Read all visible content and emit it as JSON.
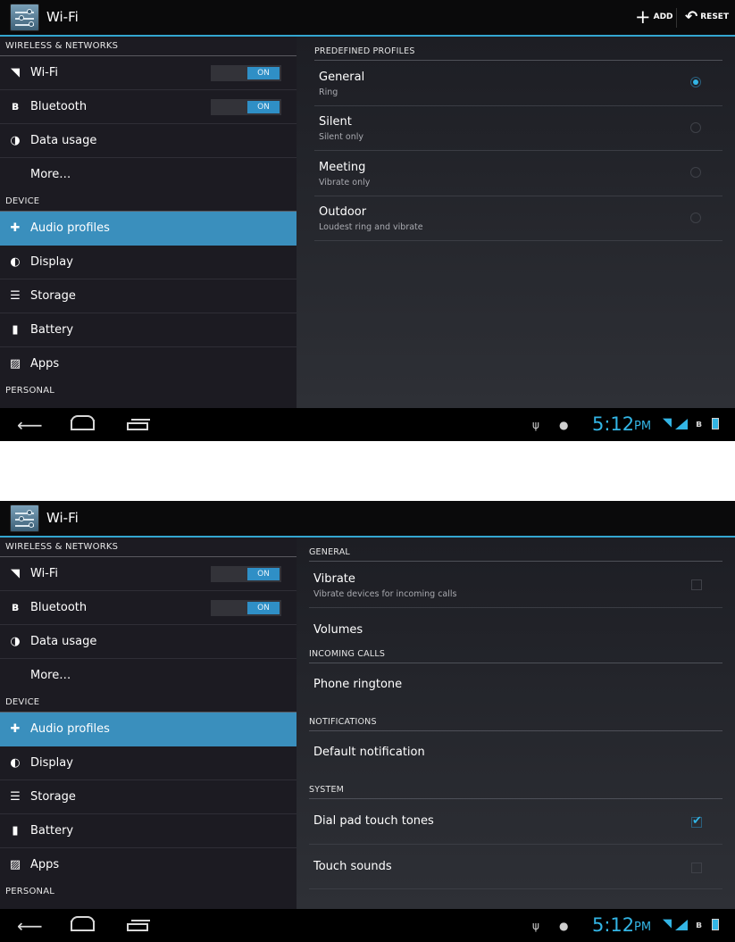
{
  "app": {
    "title": "Wi-Fi"
  },
  "actions": {
    "add": "ADD",
    "reset": "RESET"
  },
  "left": {
    "wireless_header": "WIRELESS & NETWORKS",
    "device_header": "DEVICE",
    "personal_header": "PERSONAL",
    "items": [
      {
        "label": "Wi-Fi",
        "icon": "wifi-icon",
        "toggle": "ON"
      },
      {
        "label": "Bluetooth",
        "icon": "bluetooth-icon",
        "toggle": "ON"
      },
      {
        "label": "Data usage",
        "icon": "data-usage-icon"
      },
      {
        "label": "More…"
      },
      {
        "label": "Audio profiles",
        "icon": "audio-profiles-icon",
        "selected": true
      },
      {
        "label": "Display",
        "icon": "display-icon"
      },
      {
        "label": "Storage",
        "icon": "storage-icon"
      },
      {
        "label": "Battery",
        "icon": "battery-icon"
      },
      {
        "label": "Apps",
        "icon": "apps-icon"
      }
    ]
  },
  "profiles": {
    "header": "PREDEFINED PROFILES",
    "items": [
      {
        "title": "General",
        "subtitle": "Ring",
        "selected": true
      },
      {
        "title": "Silent",
        "subtitle": "Silent only",
        "selected": false
      },
      {
        "title": "Meeting",
        "subtitle": "Vibrate only",
        "selected": false
      },
      {
        "title": "Outdoor",
        "subtitle": "Loudest ring and vibrate",
        "selected": false
      }
    ]
  },
  "general": {
    "general_header": "GENERAL",
    "vibrate_title": "Vibrate",
    "vibrate_sub": "Vibrate devices for incoming calls",
    "vibrate_checked": false,
    "volumes": "Volumes",
    "incoming_header": "INCOMING CALLS",
    "ringtone": "Phone ringtone",
    "notifications_header": "NOTIFICATIONS",
    "default_notification": "Default notification",
    "system_header": "SYSTEM",
    "dialpad": "Dial pad touch tones",
    "dialpad_checked": true,
    "touch_sounds": "Touch sounds",
    "touch_checked": false
  },
  "status": {
    "time": "5:12",
    "ampm": "PM"
  },
  "colors": {
    "accent": "#33b5e5",
    "selected_bg": "#3a8fbd"
  }
}
